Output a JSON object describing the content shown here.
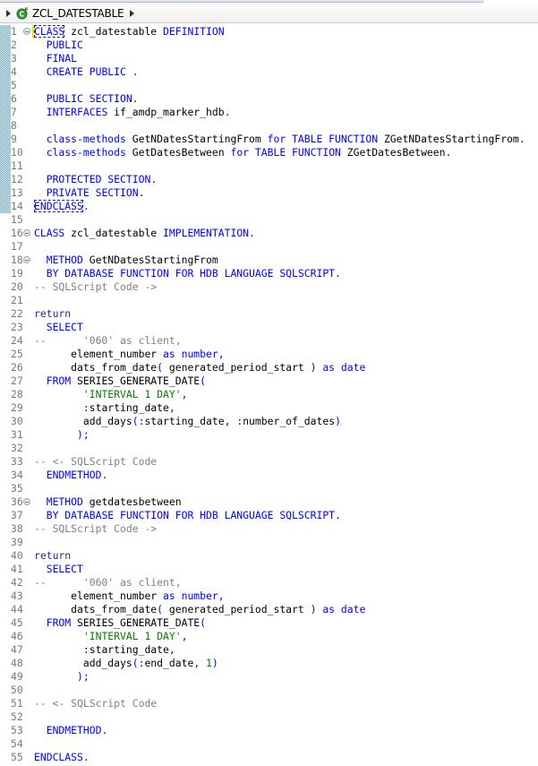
{
  "breadcrumb": {
    "class_icon": "abap-class-icon",
    "title": "ZCL_DATESTABLE",
    "arrow_icon": "chevron-right-icon"
  },
  "editor": {
    "language": "ABAP",
    "colors": {
      "keyword": "#0000ff",
      "return_keyword": "#3a1a9a",
      "identifier": "#000000",
      "punctuation": "#0000ff",
      "string": "#008000",
      "number": "#008000",
      "comment": "#808080",
      "line_number": "#787878"
    },
    "lines": [
      {
        "n": "1",
        "fold": true,
        "tokens": [
          [
            "kw",
            "CLASS",
            "sel"
          ],
          [
            "id",
            " zcl_datestable "
          ],
          [
            "kw",
            "DEFINITION"
          ]
        ]
      },
      {
        "n": "2",
        "tokens": [
          [
            "id",
            "  "
          ],
          [
            "kw",
            "PUBLIC"
          ]
        ]
      },
      {
        "n": "3",
        "tokens": [
          [
            "id",
            "  "
          ],
          [
            "kw",
            "FINAL"
          ]
        ]
      },
      {
        "n": "4",
        "tokens": [
          [
            "id",
            "  "
          ],
          [
            "kw",
            "CREATE PUBLIC "
          ],
          [
            "pn",
            "."
          ]
        ]
      },
      {
        "n": "5",
        "tokens": []
      },
      {
        "n": "6",
        "tokens": [
          [
            "id",
            "  "
          ],
          [
            "kw",
            "PUBLIC SECTION"
          ],
          [
            "pn",
            "."
          ]
        ]
      },
      {
        "n": "7",
        "tokens": [
          [
            "id",
            "  "
          ],
          [
            "kw",
            "INTERFACES"
          ],
          [
            "id",
            " if_amdp_marker_hdb"
          ],
          [
            "pn",
            "."
          ]
        ]
      },
      {
        "n": "8",
        "tokens": []
      },
      {
        "n": "9",
        "tokens": [
          [
            "id",
            "  "
          ],
          [
            "kw",
            "class-methods"
          ],
          [
            "id",
            " GetNDatesStartingFrom "
          ],
          [
            "kw",
            "for TABLE FUNCTION"
          ],
          [
            "id",
            " ZGetNDatesStartingFrom"
          ],
          [
            "pn",
            "."
          ]
        ]
      },
      {
        "n": "10",
        "tokens": [
          [
            "id",
            "  "
          ],
          [
            "kw",
            "class-methods"
          ],
          [
            "id",
            " GetDatesBetween "
          ],
          [
            "kw",
            "for TABLE FUNCTION"
          ],
          [
            "id",
            " ZGetDatesBetween"
          ],
          [
            "pn",
            "."
          ]
        ]
      },
      {
        "n": "11",
        "tokens": []
      },
      {
        "n": "12",
        "tokens": [
          [
            "id",
            "  "
          ],
          [
            "kw",
            "PROTECTED SECTION"
          ],
          [
            "pn",
            "."
          ]
        ]
      },
      {
        "n": "13",
        "tokens": [
          [
            "id",
            "  "
          ],
          [
            "kw",
            "PRIVATE SECTION"
          ],
          [
            "pn",
            "."
          ]
        ]
      },
      {
        "n": "14",
        "tokens": [
          [
            "kw",
            "ENDCLASS",
            "sel"
          ],
          [
            "pn",
            "."
          ]
        ]
      },
      {
        "n": "15",
        "tokens": []
      },
      {
        "n": "16",
        "fold": true,
        "tokens": [
          [
            "kw",
            "CLASS"
          ],
          [
            "id",
            " zcl_datestable "
          ],
          [
            "kw",
            "IMPLEMENTATION"
          ],
          [
            "pn",
            "."
          ]
        ]
      },
      {
        "n": "17",
        "tokens": []
      },
      {
        "n": "18",
        "fold": true,
        "tokens": [
          [
            "id",
            "  "
          ],
          [
            "kw",
            "METHOD"
          ],
          [
            "id",
            " GetNDatesStartingFrom"
          ]
        ]
      },
      {
        "n": "19",
        "tokens": [
          [
            "id",
            "  "
          ],
          [
            "kw",
            "BY DATABASE FUNCTION FOR HDB LANGUAGE SQLSCRIPT"
          ],
          [
            "pn",
            "."
          ]
        ]
      },
      {
        "n": "20",
        "tokens": [
          [
            "cm",
            "-- SQLScript Code ->"
          ]
        ]
      },
      {
        "n": "21",
        "tokens": []
      },
      {
        "n": "22",
        "tokens": [
          [
            "kw2",
            "return"
          ]
        ]
      },
      {
        "n": "23",
        "tokens": [
          [
            "id",
            "  "
          ],
          [
            "kw",
            "SELECT"
          ]
        ]
      },
      {
        "n": "24",
        "tokens": [
          [
            "cm",
            "--      '060' as client,"
          ]
        ]
      },
      {
        "n": "25",
        "tokens": [
          [
            "id",
            "      element_number "
          ],
          [
            "kw",
            "as number"
          ],
          [
            "pn",
            ","
          ]
        ]
      },
      {
        "n": "26",
        "tokens": [
          [
            "id",
            "      dats_from_date"
          ],
          [
            "pn",
            "("
          ],
          [
            "id",
            " generated_period_start "
          ],
          [
            "pn",
            ")"
          ],
          [
            "id",
            " "
          ],
          [
            "kw",
            "as date"
          ]
        ]
      },
      {
        "n": "27",
        "tokens": [
          [
            "id",
            "  "
          ],
          [
            "kw",
            "FROM"
          ],
          [
            "id",
            " SERIES_GENERATE_DATE"
          ],
          [
            "pn",
            "("
          ]
        ]
      },
      {
        "n": "28",
        "tokens": [
          [
            "id",
            "        "
          ],
          [
            "str",
            "'INTERVAL 1 DAY'"
          ],
          [
            "pn",
            ","
          ]
        ]
      },
      {
        "n": "29",
        "tokens": [
          [
            "id",
            "        "
          ],
          [
            "pn",
            ":"
          ],
          [
            "id",
            "starting_date"
          ],
          [
            "pn",
            ","
          ]
        ]
      },
      {
        "n": "30",
        "tokens": [
          [
            "id",
            "        add_days"
          ],
          [
            "pn",
            "(:"
          ],
          [
            "id",
            "starting_date"
          ],
          [
            "pn",
            ", :"
          ],
          [
            "id",
            "number_of_dates"
          ],
          [
            "pn",
            ")"
          ]
        ]
      },
      {
        "n": "31",
        "tokens": [
          [
            "id",
            "       "
          ],
          [
            "pn",
            ");"
          ]
        ]
      },
      {
        "n": "32",
        "tokens": []
      },
      {
        "n": "33",
        "tokens": [
          [
            "cm",
            "-- <- SQLScript Code"
          ]
        ]
      },
      {
        "n": "34",
        "tokens": [
          [
            "id",
            "  "
          ],
          [
            "kw",
            "ENDMETHOD"
          ],
          [
            "pn",
            "."
          ]
        ]
      },
      {
        "n": "35",
        "tokens": []
      },
      {
        "n": "36",
        "fold": true,
        "tokens": [
          [
            "id",
            "  "
          ],
          [
            "kw",
            "METHOD"
          ],
          [
            "id",
            " getdatesbetween"
          ]
        ]
      },
      {
        "n": "37",
        "tokens": [
          [
            "id",
            "  "
          ],
          [
            "kw",
            "BY DATABASE FUNCTION FOR HDB LANGUAGE SQLSCRIPT"
          ],
          [
            "pn",
            "."
          ]
        ]
      },
      {
        "n": "38",
        "tokens": [
          [
            "cm",
            "-- SQLScript Code ->"
          ]
        ]
      },
      {
        "n": "39",
        "tokens": []
      },
      {
        "n": "40",
        "tokens": [
          [
            "kw2",
            "return"
          ]
        ]
      },
      {
        "n": "41",
        "tokens": [
          [
            "id",
            "  "
          ],
          [
            "kw",
            "SELECT"
          ]
        ]
      },
      {
        "n": "42",
        "tokens": [
          [
            "cm",
            "--      '060' as client,"
          ]
        ]
      },
      {
        "n": "43",
        "tokens": [
          [
            "id",
            "      element_number "
          ],
          [
            "kw",
            "as number"
          ],
          [
            "pn",
            ","
          ]
        ]
      },
      {
        "n": "44",
        "tokens": [
          [
            "id",
            "      dats_from_date"
          ],
          [
            "pn",
            "("
          ],
          [
            "id",
            " generated_period_start "
          ],
          [
            "pn",
            ")"
          ],
          [
            "id",
            " "
          ],
          [
            "kw",
            "as date"
          ]
        ]
      },
      {
        "n": "45",
        "tokens": [
          [
            "id",
            "  "
          ],
          [
            "kw",
            "FROM"
          ],
          [
            "id",
            " SERIES_GENERATE_DATE"
          ],
          [
            "pn",
            "("
          ]
        ]
      },
      {
        "n": "46",
        "tokens": [
          [
            "id",
            "        "
          ],
          [
            "str",
            "'INTERVAL 1 DAY'"
          ],
          [
            "pn",
            ","
          ]
        ]
      },
      {
        "n": "47",
        "tokens": [
          [
            "id",
            "        "
          ],
          [
            "pn",
            ":"
          ],
          [
            "id",
            "starting_date"
          ],
          [
            "pn",
            ","
          ]
        ]
      },
      {
        "n": "48",
        "tokens": [
          [
            "id",
            "        add_days"
          ],
          [
            "pn",
            "(:"
          ],
          [
            "id",
            "end_date"
          ],
          [
            "pn",
            ", "
          ],
          [
            "num",
            "1"
          ],
          [
            "pn",
            ")"
          ]
        ]
      },
      {
        "n": "49",
        "tokens": [
          [
            "id",
            "       "
          ],
          [
            "pn",
            ");"
          ]
        ]
      },
      {
        "n": "50",
        "tokens": []
      },
      {
        "n": "51",
        "tokens": [
          [
            "cm",
            "-- <- SQLScript Code"
          ]
        ]
      },
      {
        "n": "52",
        "tokens": []
      },
      {
        "n": "53",
        "tokens": [
          [
            "id",
            "  "
          ],
          [
            "kw",
            "ENDMETHOD"
          ],
          [
            "pn",
            "."
          ]
        ]
      },
      {
        "n": "54",
        "tokens": []
      },
      {
        "n": "55",
        "tokens": [
          [
            "kw",
            "ENDCLASS"
          ],
          [
            "pn",
            "."
          ]
        ]
      }
    ]
  }
}
